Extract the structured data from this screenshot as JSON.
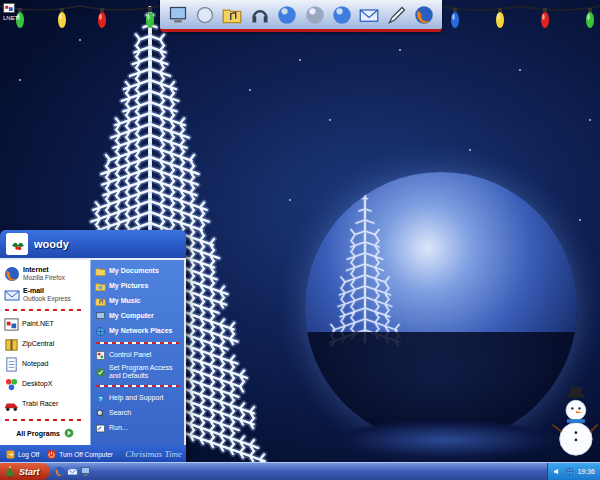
{
  "desktop": {
    "icons": [
      {
        "label": "LNET"
      }
    ]
  },
  "start_menu": {
    "user": "woody",
    "pinned": [
      {
        "title": "Internet",
        "subtitle": "Mozilla Firefox"
      },
      {
        "title": "E-mail",
        "subtitle": "Outlook Express"
      }
    ],
    "recent": [
      "Paint.NET",
      "ZipCentral",
      "Notepad",
      "DesktopX",
      "Trabi Racer"
    ],
    "all_programs": "All Programs",
    "places": [
      "My Documents",
      "My Pictures",
      "My Music",
      "My Computer",
      "My Network Places"
    ],
    "settings": [
      "Control Panel",
      "Set Program Access and Defaults"
    ],
    "tools": [
      "Help and Support",
      "Search",
      "Run..."
    ],
    "footer": {
      "log_off": "Log Off",
      "turn_off": "Turn Off Computer",
      "theme_name": "Christmas Time"
    }
  },
  "taskbar": {
    "start": "Start",
    "clock": "19:36"
  }
}
